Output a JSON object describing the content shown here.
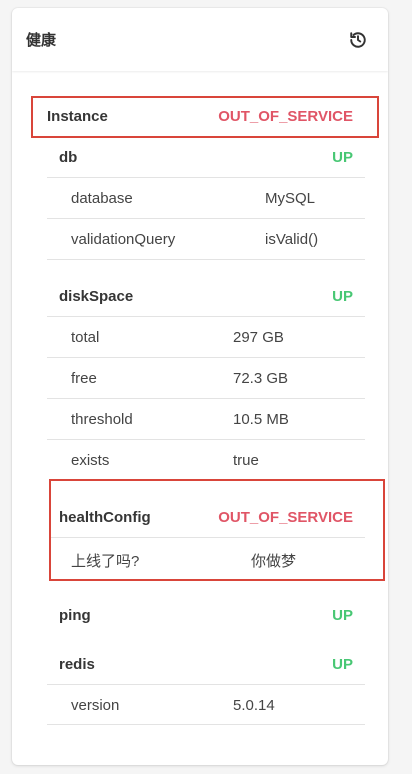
{
  "header": {
    "title": "健康",
    "icon": "history-icon"
  },
  "instance": {
    "label": "Instance",
    "status": "OUT_OF_SERVICE"
  },
  "groups": {
    "db": {
      "label": "db",
      "status": "UP",
      "rows": [
        {
          "key": "database",
          "value": "MySQL"
        },
        {
          "key": "validationQuery",
          "value": "isValid()"
        }
      ]
    },
    "diskSpace": {
      "label": "diskSpace",
      "status": "UP",
      "rows": [
        {
          "key": "total",
          "value": "297 GB"
        },
        {
          "key": "free",
          "value": "72.3 GB"
        },
        {
          "key": "threshold",
          "value": "10.5 MB"
        },
        {
          "key": "exists",
          "value": "true"
        }
      ]
    },
    "healthConfig": {
      "label": "healthConfig",
      "status": "OUT_OF_SERVICE",
      "rows": [
        {
          "key": "上线了吗?",
          "value": "你做梦"
        }
      ]
    },
    "ping": {
      "label": "ping",
      "status": "UP"
    },
    "redis": {
      "label": "redis",
      "status": "UP",
      "rows": [
        {
          "key": "version",
          "value": "5.0.14"
        }
      ]
    }
  },
  "colors": {
    "up": "#48c774",
    "out_of_service": "#e05566",
    "highlight": "#d9453a"
  }
}
